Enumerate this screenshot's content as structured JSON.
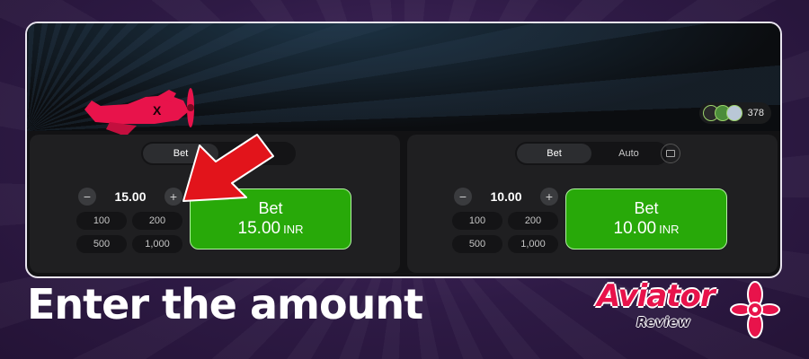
{
  "game": {
    "players_count": "378"
  },
  "panels": [
    {
      "tabs": [
        {
          "label": "Bet",
          "active": true
        },
        {
          "label": "",
          "active": false
        }
      ],
      "amount": "15.00",
      "minus": "−",
      "plus": "+",
      "quick_amounts": [
        "100",
        "200",
        "500",
        "1,000"
      ],
      "bet_button": {
        "title": "Bet",
        "amount": "15.00",
        "currency": "INR",
        "color": "#28a909"
      }
    },
    {
      "tabs": [
        {
          "label": "Bet",
          "active": true
        },
        {
          "label": "Auto",
          "active": false
        }
      ],
      "amount": "10.00",
      "minus": "−",
      "plus": "+",
      "quick_amounts": [
        "100",
        "200",
        "500",
        "1,000"
      ],
      "bet_button": {
        "title": "Bet",
        "amount": "10.00",
        "currency": "INR",
        "color": "#28a909"
      }
    }
  ],
  "caption": "Enter the amount",
  "logo": {
    "word": "Aviator",
    "sub": "Review",
    "color": "#e8134b"
  },
  "icons": {
    "arrow": "red-pointer-arrow-icon",
    "plane": "red-airplane-icon",
    "collapse": "collapse-panel-icon",
    "propeller": "propeller-logo-icon"
  }
}
